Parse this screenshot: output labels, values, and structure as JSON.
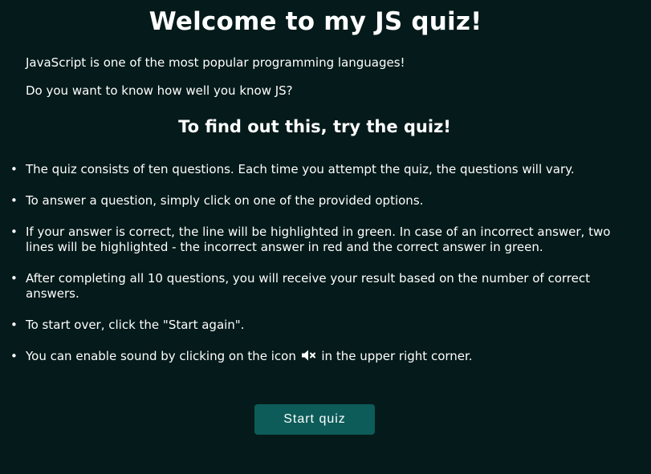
{
  "header": {
    "title": "Welcome to my JS quiz!"
  },
  "intro": {
    "line1": "JavaScript is one of the most popular programming languages!",
    "line2": "Do you want to know how well you know JS?"
  },
  "subtitle": "To find out this, try the quiz!",
  "rules": [
    {
      "text": "The quiz consists of ten questions. Each time you attempt the quiz, the questions will vary."
    },
    {
      "text": "To answer a question, simply click on one of the provided options."
    },
    {
      "text": "If your answer is correct, the line will be highlighted in green. In case of an incorrect answer, two lines will be highlighted - the incorrect answer in red and the correct answer in green."
    },
    {
      "text": "After completing all 10 questions, you will receive your result based on the number of correct answers."
    },
    {
      "text": "To start over, click the \"Start again\"."
    },
    {
      "text_before": "You can enable sound by clicking on the icon",
      "icon": "sound-muted-icon",
      "text_after": "in the upper right corner."
    }
  ],
  "start_button": {
    "label": "Start quiz"
  },
  "colors": {
    "background": "#051a1a",
    "button": "#0d5c59",
    "text": "#ffffff"
  }
}
